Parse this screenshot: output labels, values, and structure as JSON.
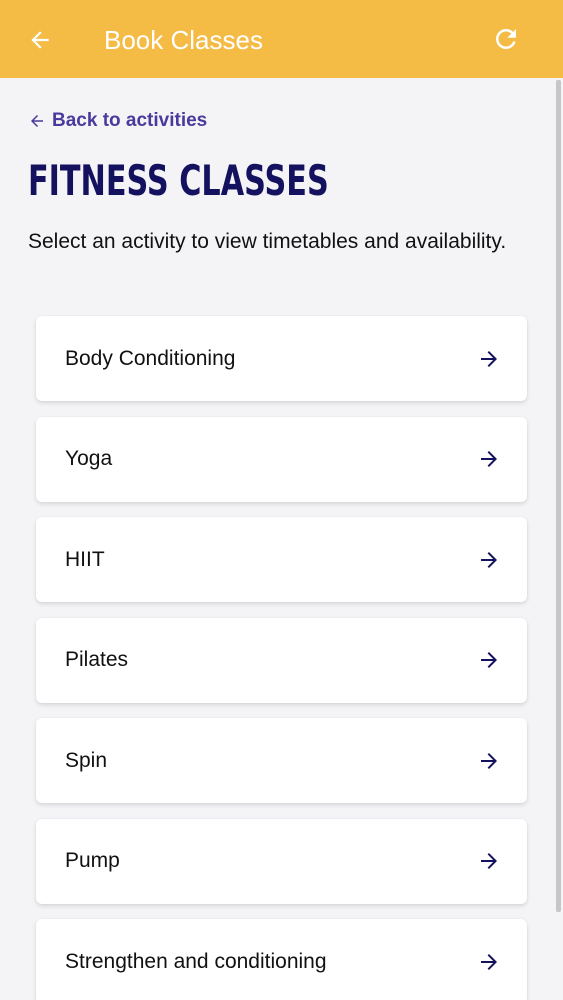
{
  "appbar": {
    "title": "Book Classes",
    "back_icon": "arrow-left-icon",
    "refresh_icon": "refresh-icon",
    "background": "#f4bb45"
  },
  "back_link": {
    "label": "Back to activities",
    "color": "#4a3a9c"
  },
  "page": {
    "title": "FITNESS CLASSES",
    "subtitle": "Select an activity to view timetables and availability."
  },
  "classes": [
    {
      "label": "Body Conditioning"
    },
    {
      "label": "Yoga"
    },
    {
      "label": "HIIT"
    },
    {
      "label": "Pilates"
    },
    {
      "label": "Spin"
    },
    {
      "label": "Pump"
    },
    {
      "label": "Strengthen and conditioning"
    }
  ],
  "colors": {
    "title": "#14125f",
    "arrow": "#14125f"
  }
}
